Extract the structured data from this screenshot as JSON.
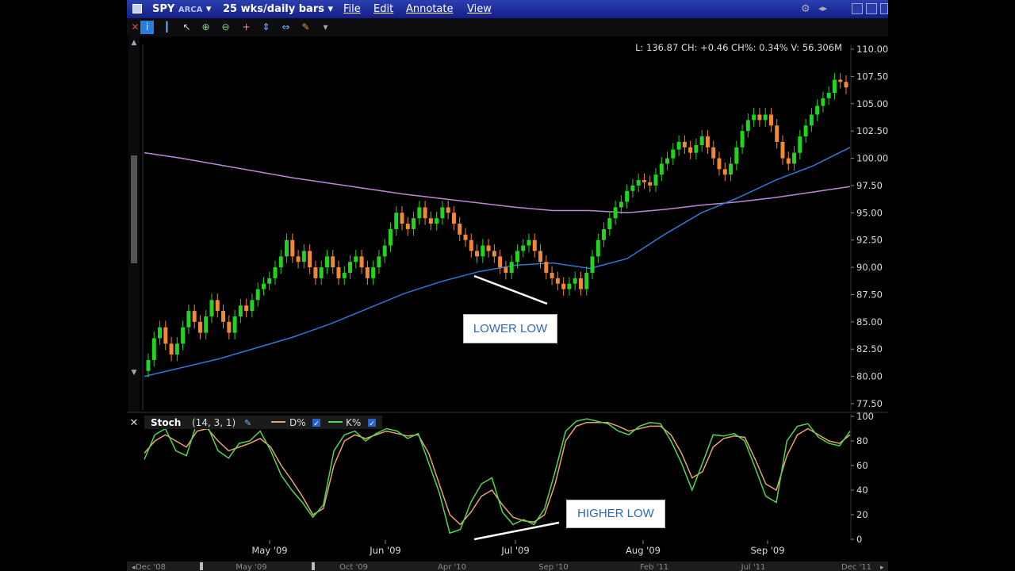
{
  "window": {
    "symbol": "SPY",
    "exchange": "ARCA",
    "period": "25 wks/daily bars",
    "menu": [
      "File",
      "Edit",
      "Annotate",
      "View"
    ]
  },
  "readout": "L: 136.87 CH: +0.46 CH%: 0.34% V: 56.306M",
  "indicator": {
    "name": "Stoch",
    "params": "(14, 3, 1)",
    "d_label": "D%",
    "k_label": "K%"
  },
  "annotations": {
    "lower_low": "LOWER LOW",
    "higher_low": "HIGHER LOW"
  },
  "colors": {
    "up": "#22d322",
    "down": "#f0883a",
    "ma_slow": "#b98ad6",
    "ma_fast": "#2e79d6",
    "d_line": "#e8a36c",
    "k_line": "#4ed84e"
  },
  "chart_data": [
    {
      "type": "candlestick",
      "title": "SPY ARCA 25 wks/daily bars",
      "ylim": [
        77.5,
        110
      ],
      "yticks": [
        "110.00",
        "107.50",
        "105.00",
        "102.50",
        "100.00",
        "97.50",
        "95.00",
        "92.50",
        "90.00",
        "87.50",
        "85.00",
        "82.50",
        "80.00",
        "77.50"
      ],
      "x_labels": [
        "May '09",
        "Jun '09",
        "Jul '09",
        "Aug '09",
        "Sep '09"
      ],
      "close": [
        81.5,
        83.5,
        84.5,
        83,
        82,
        83,
        84.5,
        86,
        85,
        84,
        85.5,
        87,
        86,
        85,
        84,
        85.5,
        86.5,
        86,
        87,
        88,
        88.5,
        89,
        90,
        91,
        92.5,
        91,
        90.5,
        91.5,
        90,
        89,
        90,
        91,
        90,
        89,
        89.5,
        90.5,
        91,
        90,
        89,
        90,
        91,
        92,
        93.5,
        95,
        94,
        93.5,
        94.5,
        95.5,
        94.5,
        94,
        94.5,
        95.5,
        95,
        94,
        93,
        92.5,
        91.5,
        91,
        92,
        91.5,
        91,
        90,
        89.5,
        90.5,
        91.5,
        92,
        92.5,
        91.5,
        90.5,
        89.5,
        89,
        88.5,
        88,
        88.5,
        89,
        88,
        89.5,
        91,
        92.5,
        93.5,
        94.5,
        95.5,
        96,
        97,
        97.5,
        98,
        97.8,
        97.5,
        98.5,
        99.5,
        100,
        100.8,
        101.5,
        101,
        100.5,
        101.2,
        102,
        101,
        100,
        99,
        98.5,
        99.5,
        101,
        102.5,
        103.5,
        104,
        103.5,
        104,
        103,
        101.5,
        100,
        99.5,
        100.5,
        102,
        103,
        104,
        104.8,
        105.5,
        106,
        107.2,
        107,
        106.5
      ],
      "series": [
        {
          "name": "slow MA",
          "values": [
            100.5,
            100,
            99.4,
            98.8,
            98.2,
            97.7,
            97.2,
            96.7,
            96.3,
            95.9,
            95.5,
            95.2,
            95.2,
            95,
            95.3,
            95.7,
            96,
            96.4,
            96.9,
            97.4
          ]
        },
        {
          "name": "fast MA",
          "values": [
            80,
            80.8,
            81.6,
            82.6,
            83.6,
            84.8,
            86.2,
            87.6,
            88.7,
            89.6,
            90.2,
            90.4,
            89.9,
            90.8,
            93,
            95,
            96.4,
            98,
            99.3,
            101
          ]
        }
      ]
    },
    {
      "type": "line",
      "title": "Stoch (14, 3, 1)",
      "ylim": [
        0,
        100
      ],
      "yticks": [
        "100",
        "80",
        "60",
        "40",
        "20",
        "0"
      ],
      "series": [
        {
          "name": "D%",
          "values": [
            70,
            80,
            85,
            80,
            75,
            88,
            90,
            80,
            72,
            75,
            78,
            82,
            75,
            60,
            48,
            35,
            20,
            25,
            60,
            80,
            85,
            82,
            85,
            88,
            86,
            84,
            85,
            70,
            45,
            20,
            12,
            22,
            35,
            40,
            28,
            18,
            15,
            14,
            20,
            45,
            80,
            92,
            95,
            95,
            95,
            92,
            88,
            90,
            92,
            92,
            85,
            70,
            50,
            55,
            75,
            82,
            84,
            83,
            65,
            45,
            40,
            68,
            85,
            90,
            85,
            80,
            78,
            85
          ]
        },
        {
          "name": "K%",
          "values": [
            65,
            85,
            90,
            72,
            68,
            95,
            92,
            72,
            66,
            78,
            80,
            88,
            72,
            52,
            40,
            30,
            18,
            28,
            72,
            85,
            88,
            80,
            86,
            90,
            88,
            82,
            86,
            62,
            38,
            5,
            8,
            30,
            45,
            50,
            22,
            12,
            16,
            12,
            25,
            55,
            88,
            96,
            98,
            96,
            94,
            88,
            85,
            92,
            95,
            94,
            80,
            62,
            40,
            62,
            85,
            84,
            86,
            80,
            58,
            35,
            30,
            80,
            92,
            94,
            83,
            78,
            76,
            88
          ]
        }
      ]
    }
  ],
  "bottom_axis": [
    "Dec '08",
    "May '09",
    "Oct '09",
    "Apr '10",
    "Sep '10",
    "Feb '11",
    "Jul '11",
    "Dec '11"
  ]
}
